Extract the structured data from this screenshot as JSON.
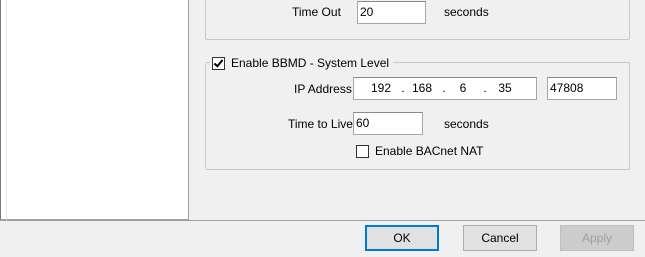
{
  "top_group": {
    "timeout_label": "Time Out",
    "timeout_value": "20",
    "timeout_unit": "seconds"
  },
  "bbmd": {
    "enable_label": "Enable BBMD - System Level",
    "enable_checked": true,
    "ip_label": "IP Address",
    "ip_octets": [
      "192",
      "168",
      "6",
      "35"
    ],
    "ip_dot": ".",
    "port_value": "47808",
    "ttl_label": "Time to Live",
    "ttl_value": "60",
    "ttl_unit": "seconds",
    "nat_label": "Enable BACnet NAT",
    "nat_checked": false
  },
  "buttons": {
    "ok": "OK",
    "cancel": "Cancel",
    "apply": "Apply"
  }
}
